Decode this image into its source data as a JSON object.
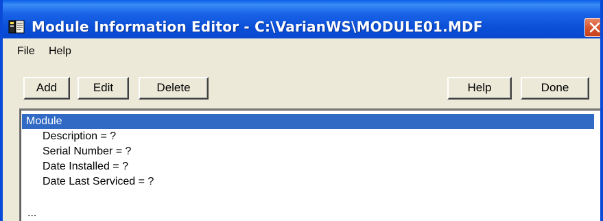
{
  "window": {
    "title": "Module Information Editor - C:\\VarianWS\\MODULE01.MDF",
    "icon": "app-icon",
    "close_icon": "close-icon"
  },
  "menu": {
    "items": [
      {
        "label": "File"
      },
      {
        "label": "Help"
      }
    ]
  },
  "toolbar": {
    "add_label": "Add",
    "edit_label": "Edit",
    "delete_label": "Delete",
    "help_label": "Help",
    "done_label": "Done"
  },
  "list": {
    "items": [
      {
        "text": "Module",
        "selected": true,
        "level": 0
      },
      {
        "text": "Description = ?",
        "selected": false,
        "level": 1
      },
      {
        "text": "Serial Number = ?",
        "selected": false,
        "level": 1
      },
      {
        "text": "Date Installed = ?",
        "selected": false,
        "level": 1
      },
      {
        "text": "Date Last Serviced = ?",
        "selected": false,
        "level": 1
      },
      {
        "text": "...",
        "selected": false,
        "level": 0
      }
    ]
  },
  "colors": {
    "titlebar": "#0b50d8",
    "selection": "#316ac5",
    "close_button": "#d8552f",
    "window_face": "#ece9d8"
  }
}
